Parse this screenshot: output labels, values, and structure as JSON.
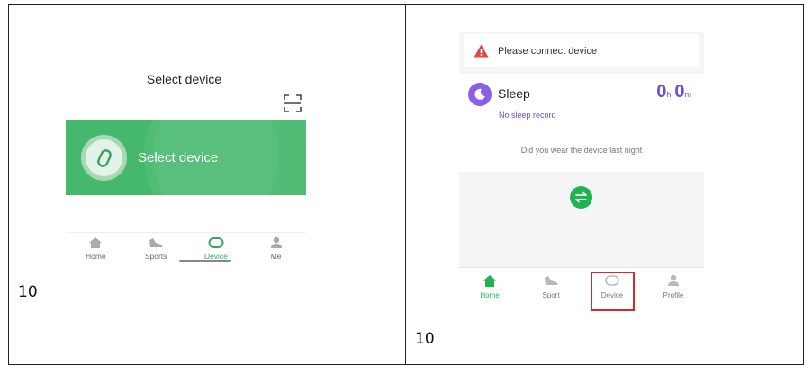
{
  "steps": {
    "left_number": "10",
    "right_number": "10"
  },
  "left_screen": {
    "title": "Select device",
    "card_label": "Select device",
    "nav": [
      {
        "label": "Home",
        "icon": "home-icon"
      },
      {
        "label": "Sports",
        "icon": "shoe-icon"
      },
      {
        "label": "Device",
        "icon": "band-icon",
        "active": true
      },
      {
        "label": "Me",
        "icon": "person-icon"
      }
    ]
  },
  "right_screen": {
    "alert": "Please connect device",
    "sleep_title": "Sleep",
    "duration": {
      "hours": "0",
      "h_unit": "h",
      "minutes": "0",
      "m_unit": "m"
    },
    "no_record": "No sleep record",
    "question": "Did you wear the device last night",
    "nav": [
      {
        "label": "Home",
        "icon": "home-icon",
        "active": true
      },
      {
        "label": "Sport",
        "icon": "shoe-icon"
      },
      {
        "label": "Device",
        "icon": "band-icon",
        "highlighted": true
      },
      {
        "label": "Profile",
        "icon": "person-icon"
      }
    ]
  },
  "colors": {
    "card_green": "#46b86e",
    "accent_green": "#21b254",
    "purple": "#6c4fd9",
    "highlight_red": "#d42a2a",
    "warning_red": "#e04848"
  }
}
